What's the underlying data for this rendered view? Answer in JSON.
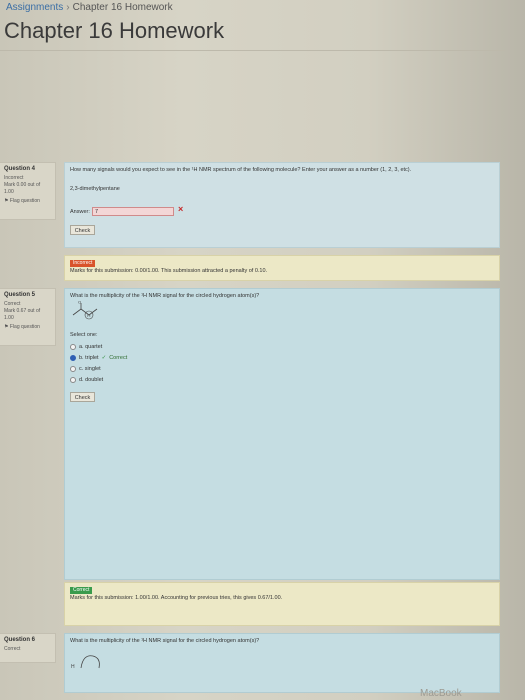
{
  "breadcrumb": {
    "root": "Assignments",
    "separator": "›",
    "current": "Chapter 16 Homework"
  },
  "page_title": "Chapter 16 Homework",
  "questions": [
    {
      "number": "Question 4",
      "status": "Incorrect",
      "marks": "Mark 0.00 out of 1.00",
      "flag": "Flag question",
      "text": "How many signals would you expect to see in the ¹H NMR spectrum of the following molecule? Enter your answer as a number (1, 2, 3, etc).",
      "molecule": "2,3-dimethylpentane",
      "answer_label": "Answer:",
      "answer_value": "7",
      "check_label": "Check",
      "feedback_badge": "Incorrect",
      "feedback_text": "Marks for this submission: 0.00/1.00. This submission attracted a penalty of 0.10."
    },
    {
      "number": "Question 5",
      "status": "Correct",
      "marks": "Mark 0.67 out of 1.00",
      "flag": "Flag question",
      "text": "What is the multiplicity of the ¹H NMR signal for the circled hydrogen atom(s)?",
      "select_label": "Select one:",
      "options": [
        {
          "label": "a. quartet",
          "selected": false
        },
        {
          "label": "b. triplet",
          "selected": true
        },
        {
          "label": "c. singlet",
          "selected": false
        },
        {
          "label": "d. doublet",
          "selected": false
        }
      ],
      "correct_tag": "Correct",
      "check_label": "Check",
      "feedback_badge": "Correct",
      "feedback_text": "Marks for this submission: 1.00/1.00. Accounting for previous tries, this gives 0.67/1.00."
    },
    {
      "number": "Question 6",
      "status": "Correct",
      "text": "What is the multiplicity of the ¹H NMR signal for the circled hydrogen atom(s)?"
    }
  ],
  "watermark": "MacBook",
  "colors": {
    "link": "#3a6ea5",
    "incorrect": "#d9542b",
    "correct": "#3a9b4c",
    "selected_radio": "#2f5fb3"
  }
}
